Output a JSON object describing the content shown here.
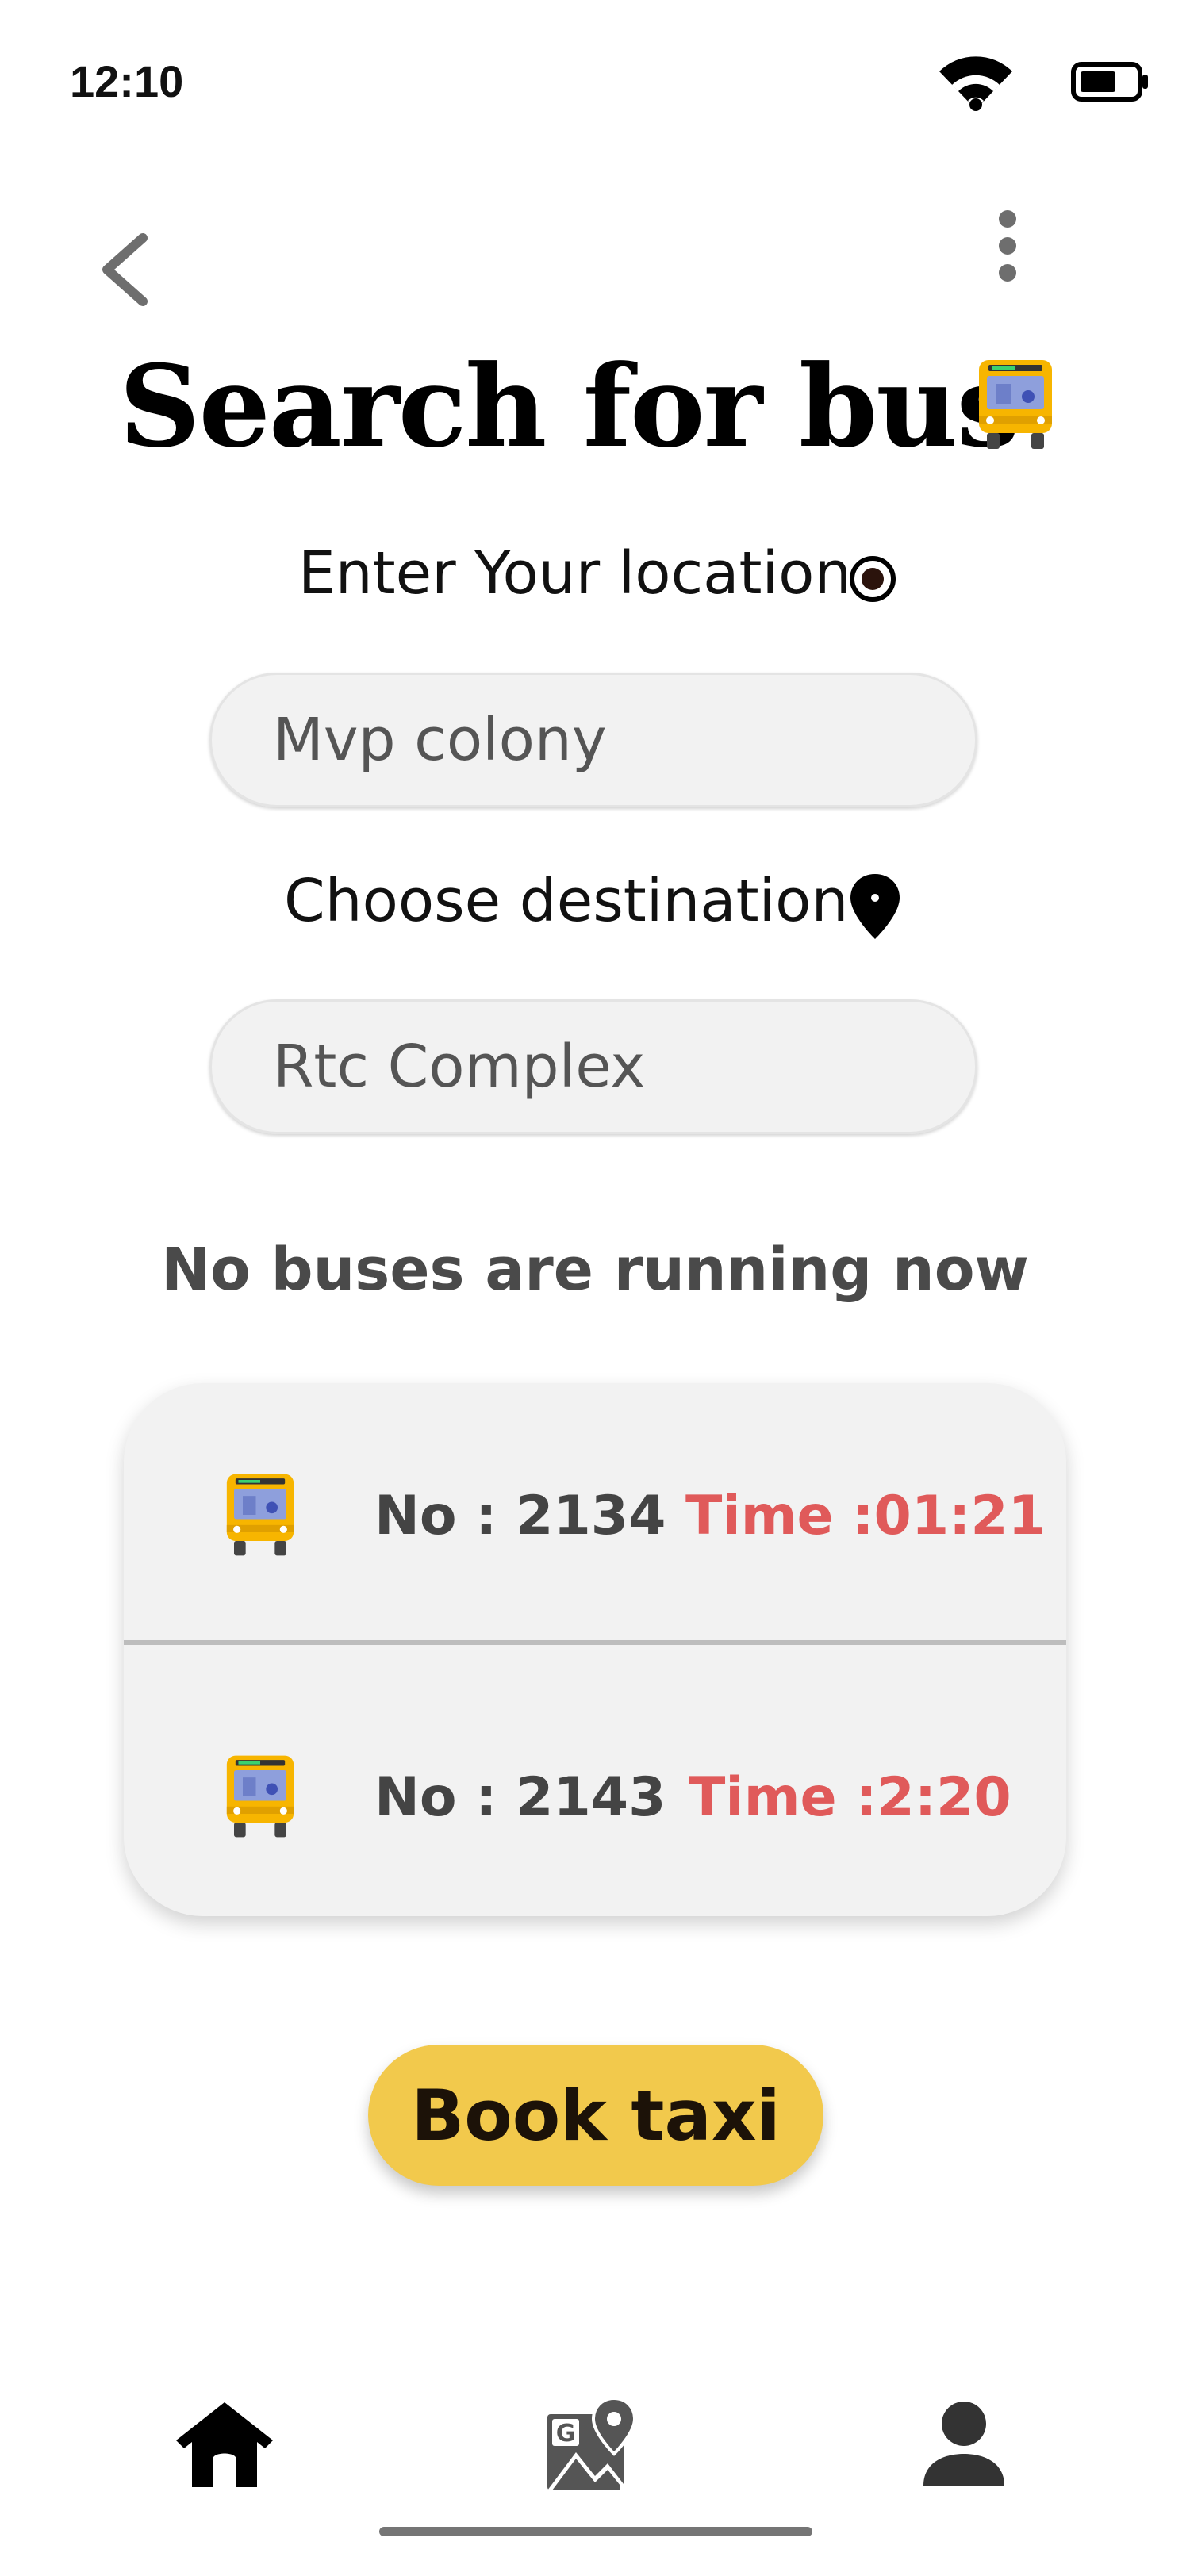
{
  "status_bar": {
    "time": "12:10"
  },
  "header": {
    "title": "Search for bus"
  },
  "location": {
    "label": "Enter Your location",
    "value": "Mvp colony"
  },
  "destination": {
    "label": "Choose destination",
    "value": "Rtc Complex"
  },
  "notice": "No buses are running now",
  "buses": [
    {
      "number": "No : 2134",
      "time": "Time :01:21"
    },
    {
      "number": "No : 2143",
      "time": "Time :2:20"
    }
  ],
  "actions": {
    "book_taxi": "Book taxi"
  },
  "bottom_nav": [
    {
      "icon": "home-icon"
    },
    {
      "icon": "map-icon"
    },
    {
      "icon": "user-icon"
    }
  ],
  "colors": {
    "accent": "#f2c94c",
    "time_red": "#e05a5a",
    "bus_yellow": "#f7b500"
  }
}
